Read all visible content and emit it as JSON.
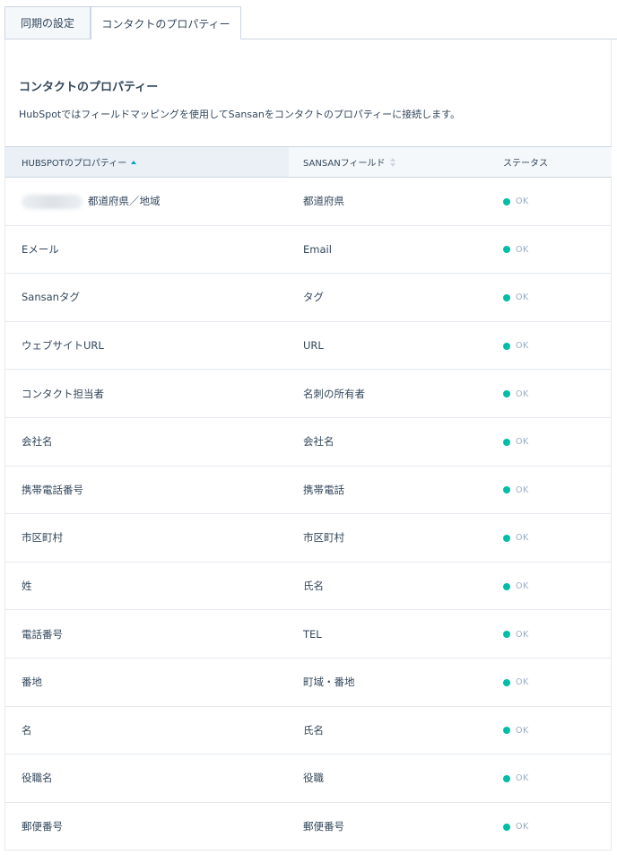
{
  "tabs": [
    {
      "label": "同期の設定"
    },
    {
      "label": "コンタクトのプロパティー"
    }
  ],
  "section": {
    "title": "コンタクトのプロパティー",
    "description": "HubSpotではフィールドマッピングを使用してSansanをコンタクトのプロパティーに接続します。"
  },
  "table": {
    "headers": {
      "hubspot": "HUBSPOTのプロパティー",
      "sansan": "SANSANフィールド",
      "status": "ステータス"
    },
    "rows": [
      {
        "hubspot": "都道府県／地域",
        "sansan": "都道府県",
        "status": "OK"
      },
      {
        "hubspot": "Eメール",
        "sansan": "Email",
        "status": "OK"
      },
      {
        "hubspot": "Sansanタグ",
        "sansan": "タグ",
        "status": "OK"
      },
      {
        "hubspot": "ウェブサイトURL",
        "sansan": "URL",
        "status": "OK"
      },
      {
        "hubspot": "コンタクト担当者",
        "sansan": "名刺の所有者",
        "status": "OK"
      },
      {
        "hubspot": "会社名",
        "sansan": "会社名",
        "status": "OK"
      },
      {
        "hubspot": "携帯電話番号",
        "sansan": "携帯電話",
        "status": "OK"
      },
      {
        "hubspot": "市区町村",
        "sansan": "市区町村",
        "status": "OK"
      },
      {
        "hubspot": "姓",
        "sansan": "氏名",
        "status": "OK"
      },
      {
        "hubspot": "電話番号",
        "sansan": "TEL",
        "status": "OK"
      },
      {
        "hubspot": "番地",
        "sansan": "町域・番地",
        "status": "OK"
      },
      {
        "hubspot": "名",
        "sansan": "氏名",
        "status": "OK"
      },
      {
        "hubspot": "役職名",
        "sansan": "役職",
        "status": "OK"
      },
      {
        "hubspot": "郵便番号",
        "sansan": "郵便番号",
        "status": "OK"
      }
    ]
  },
  "colors": {
    "status_ok": "#00bda5",
    "sort_active": "#00a4bd"
  },
  "icons": {
    "sort_hubspot": "sort-ascending-icon",
    "sort_sansan": "sort-neutral-icon",
    "status": "status-dot-icon"
  }
}
